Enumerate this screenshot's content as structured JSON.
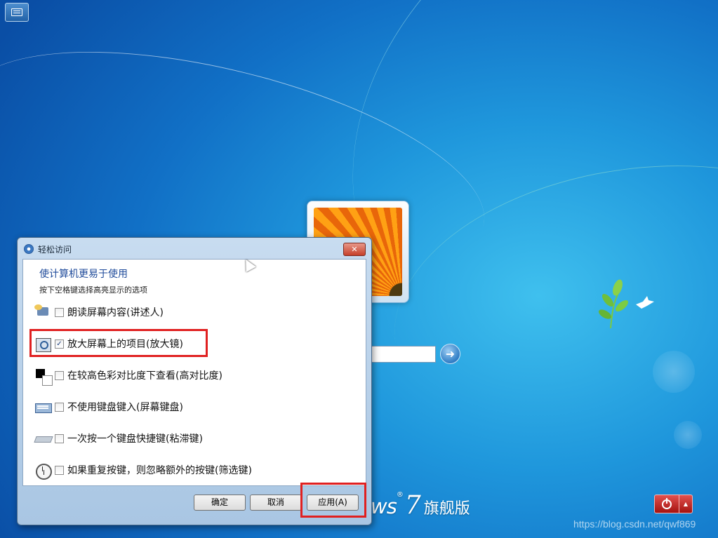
{
  "desktop": {
    "brand": {
      "product_fragment": "ws",
      "version": "7",
      "edition": "旗舰版"
    },
    "watermark": "https://blog.csdn.net/qwf869",
    "go_arrow": "➜",
    "power_arrow": "▲"
  },
  "dialog": {
    "title": "轻松访问",
    "close_glyph": "✕",
    "heading": "使计算机更易于使用",
    "subheading": "按下空格键选择高亮显示的选项",
    "options": [
      {
        "label": "朗读屏幕内容(讲述人)",
        "checked": false,
        "icon": "narrator-icon"
      },
      {
        "label": "放大屏幕上的项目(放大镜)",
        "checked": true,
        "icon": "magnifier-icon"
      },
      {
        "label": "在较高色彩对比度下查看(高对比度)",
        "checked": false,
        "icon": "high-contrast-icon"
      },
      {
        "label": "不使用键盘键入(屏幕键盘)",
        "checked": false,
        "icon": "on-screen-keyboard-icon"
      },
      {
        "label": "一次按一个键盘快捷键(粘滞键)",
        "checked": false,
        "icon": "sticky-keys-icon"
      },
      {
        "label": "如果重复按键，则忽略额外的按键(筛选键)",
        "checked": false,
        "icon": "filter-keys-icon"
      }
    ],
    "checkmark": "✓",
    "buttons": {
      "ok": "确定",
      "cancel": "取消",
      "apply": "应用(A)"
    }
  },
  "colors": {
    "highlight": "#e02020",
    "heading": "#1e4a9a"
  }
}
